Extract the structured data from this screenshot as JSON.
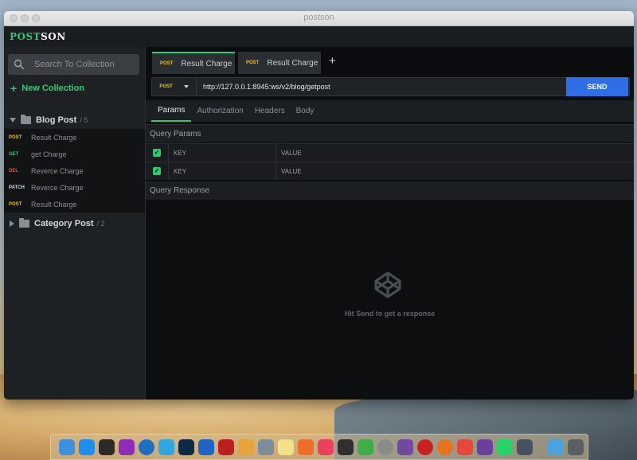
{
  "window": {
    "title": "postson"
  },
  "app": {
    "logo_a": "POST",
    "logo_b": "SON"
  },
  "sidebar": {
    "search_placeholder": "Search To Collection",
    "new_collection": "New Collection",
    "folders": [
      {
        "name": "Blog Post",
        "count": "/ 5",
        "expanded": true
      },
      {
        "name": "Category Post",
        "count": "/ 2",
        "expanded": false
      }
    ],
    "requests": [
      {
        "method": "POST",
        "label": "Result Charge"
      },
      {
        "method": "GET",
        "label": "get Charge"
      },
      {
        "method": "DEL",
        "label": "Reverce Charge"
      },
      {
        "method": "PATCH",
        "label": "Reverce Charge"
      },
      {
        "method": "POST",
        "label": "Result Charge"
      }
    ]
  },
  "tabs": [
    {
      "method": "POST",
      "label": "Result Charge",
      "active": true
    },
    {
      "method": "POST",
      "label": "Result Charge",
      "active": false
    }
  ],
  "add_tab": "+",
  "request": {
    "method": "POST",
    "url": "http://127.0.0.1:8945:ws/v2/blog/getpost",
    "send": "SEND"
  },
  "subtabs": [
    "Params",
    "Authorization",
    "Headers",
    "Body"
  ],
  "params": {
    "title": "Query Params",
    "rows": [
      {
        "key": "KEY",
        "value": "VALUE",
        "checked": true
      },
      {
        "key": "KEY",
        "value": "VALUE",
        "checked": true
      }
    ]
  },
  "response": {
    "title": "Query Response",
    "hint": "Hit Send to get a response"
  },
  "colors": {
    "accent": "#2ecc71",
    "post": "#f1c40f",
    "get": "#2ecc71",
    "del": "#e74c3c",
    "send": "#2f6ee6"
  },
  "dock": [
    "finder-icon",
    "safari-icon",
    "terminal-icon",
    "phpstorm-icon",
    "quicktime-icon",
    "telegram-icon",
    "photoshop-icon",
    "firefox-dev-icon",
    "filezilla-icon",
    "chrome-icon",
    "launchpad-icon",
    "notes-icon",
    "safari-icon",
    "music-icon",
    "vectorize-icon",
    "android-icon",
    "settings-icon",
    "rocket-icon",
    "opera-icon",
    "firefox-icon",
    "git-icon",
    "github-icon",
    "whatsapp-icon",
    "electron-icon",
    "downloads-icon",
    "trash-icon"
  ]
}
